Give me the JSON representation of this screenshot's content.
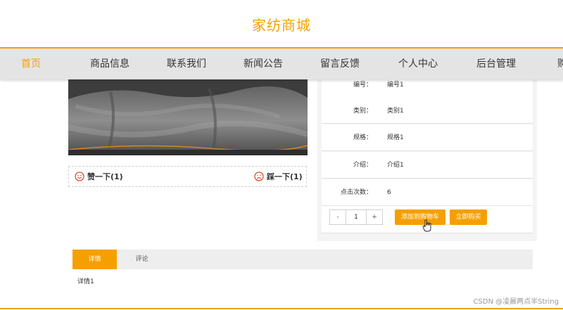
{
  "site": {
    "title": "家纺商城"
  },
  "nav": {
    "items": [
      {
        "label": "首页",
        "active": true
      },
      {
        "label": "商品信息"
      },
      {
        "label": "联系我们"
      },
      {
        "label": "新闻公告"
      },
      {
        "label": "留言反馈"
      },
      {
        "label": "个人中心"
      },
      {
        "label": "后台管理"
      },
      {
        "label": "购"
      }
    ]
  },
  "vote": {
    "like_label": "赞一下(1)",
    "dislike_label": "踩一下(1)"
  },
  "product": {
    "rows": [
      {
        "label": "编号：",
        "value": "编号1"
      },
      {
        "label": "类别：",
        "value": "类别1"
      },
      {
        "label": "规格：",
        "value": "规格1"
      },
      {
        "label": "介绍：",
        "value": "介绍1"
      },
      {
        "label": "点击次数：",
        "value": "6"
      }
    ],
    "quantity": {
      "minus": "-",
      "value": "1",
      "plus": "+"
    },
    "add_to_cart_label": "添加到购物车",
    "buy_now_label": "立即购买"
  },
  "tabs": {
    "detail_label": "详情",
    "comments_label": "评论"
  },
  "detail": {
    "text": "详情1"
  },
  "watermark": "CSDN @凌晨两点半String",
  "colors": {
    "accent": "#f5a000",
    "nav_bg": "#e4e4e4"
  }
}
